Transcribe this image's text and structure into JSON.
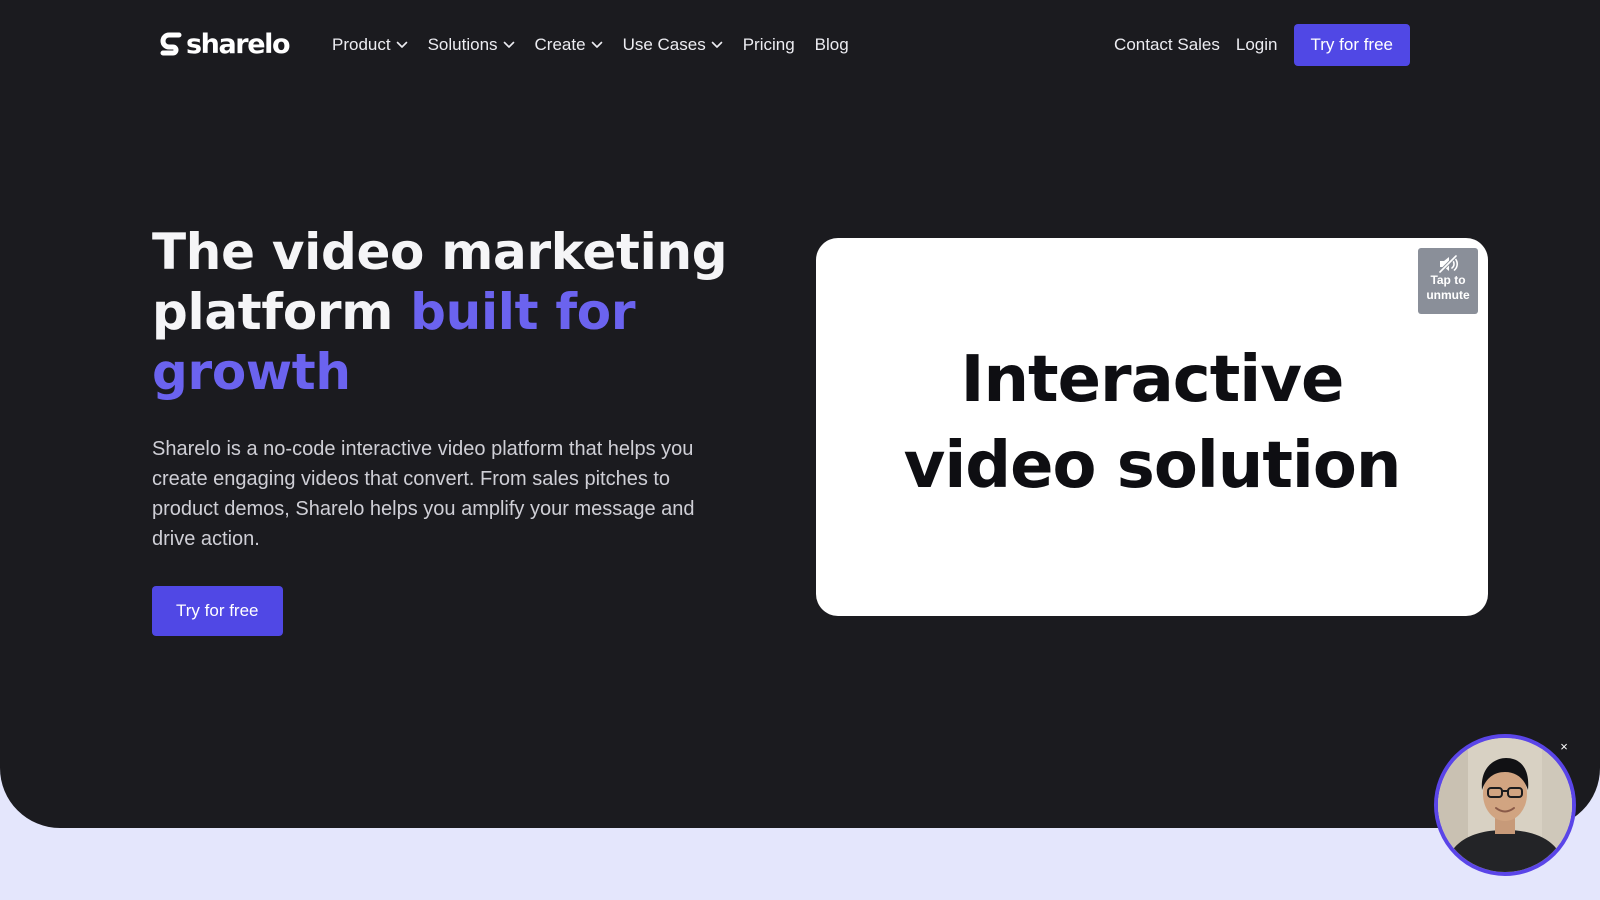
{
  "brand": {
    "name": "sharelo"
  },
  "nav": {
    "items": [
      {
        "label": "Product",
        "has_dropdown": true
      },
      {
        "label": "Solutions",
        "has_dropdown": true
      },
      {
        "label": "Create",
        "has_dropdown": true
      },
      {
        "label": "Use Cases",
        "has_dropdown": true
      },
      {
        "label": "Pricing",
        "has_dropdown": false
      },
      {
        "label": "Blog",
        "has_dropdown": false
      }
    ],
    "contact_sales": "Contact Sales",
    "login": "Login",
    "cta": "Try for free"
  },
  "hero": {
    "headline_part1": "The video marketing platform",
    "headline_accent": "built for growth",
    "description": "Sharelo is a no-code interactive video platform that helps you create engaging videos that convert. From sales pitches to product demos, Sharelo helps you amplify your message and drive action.",
    "cta": "Try for free"
  },
  "video": {
    "title_line1": "Interactive",
    "title_line2": "video solution",
    "unmute_line1": "Tap to",
    "unmute_line2": "unmute",
    "unmute_icon": "muted-speaker-icon"
  },
  "bubble": {
    "close_label": "×"
  },
  "colors": {
    "hero_bg": "#1b1b1f",
    "accent": "#5048e5",
    "headline_accent": "#6b63ef",
    "lower_bg": "#e4e6fc",
    "bubble_ring": "#5a45e8"
  }
}
